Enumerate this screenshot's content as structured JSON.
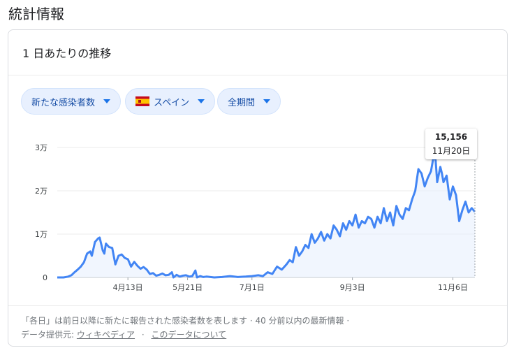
{
  "page": {
    "title": "統計情報"
  },
  "card": {
    "header": "1 日あたりの推移",
    "filters": [
      {
        "label": "新たな感染者数"
      },
      {
        "label": "スペイン",
        "flag": "spain-flag-icon"
      },
      {
        "label": "全期間"
      }
    ]
  },
  "tooltip": {
    "value": "15,156",
    "date": "11月20日"
  },
  "footer": {
    "note": "「各日」は前日以降に新たに報告された感染者数を表します · 40 分前以内の最新情報 ·",
    "provider_prefix": "データ提供元:",
    "provider_link": "ウィキペディア",
    "about_link": "このデータについて"
  },
  "colors": {
    "line": "#4285f4",
    "area": "#e8f0fe",
    "chip_bg": "#e8f0fe",
    "chip_text": "#174ea6"
  },
  "chart_data": {
    "type": "area",
    "ylim": [
      0,
      30000
    ],
    "y_ticks": [
      {
        "value": 0,
        "label": "0"
      },
      {
        "value": 10000,
        "label": "1万"
      },
      {
        "value": 20000,
        "label": "2万"
      },
      {
        "value": 30000,
        "label": "3万"
      }
    ],
    "x_ticks": [
      {
        "x": 45,
        "label": "4月13日"
      },
      {
        "x": 83,
        "label": "5月21日"
      },
      {
        "x": 124,
        "label": "7月1日"
      },
      {
        "x": 188,
        "label": "9月3日"
      },
      {
        "x": 252,
        "label": "11月6日"
      }
    ],
    "x_range": [
      0,
      266
    ],
    "series": [
      {
        "points": [
          [
            0,
            0
          ],
          [
            4,
            0
          ],
          [
            7,
            200
          ],
          [
            9,
            500
          ],
          [
            11,
            1200
          ],
          [
            13,
            1800
          ],
          [
            15,
            2500
          ],
          [
            17,
            3500
          ],
          [
            19,
            5500
          ],
          [
            21,
            6000
          ],
          [
            22,
            5000
          ],
          [
            24,
            8200
          ],
          [
            26,
            9000
          ],
          [
            27,
            9200
          ],
          [
            29,
            6200
          ],
          [
            30,
            5500
          ],
          [
            31,
            7800
          ],
          [
            33,
            7000
          ],
          [
            35,
            6800
          ],
          [
            37,
            3000
          ],
          [
            39,
            5000
          ],
          [
            41,
            5300
          ],
          [
            43,
            4500
          ],
          [
            45,
            4200
          ],
          [
            47,
            2500
          ],
          [
            49,
            3600
          ],
          [
            51,
            2700
          ],
          [
            53,
            2000
          ],
          [
            55,
            2400
          ],
          [
            57,
            1800
          ],
          [
            59,
            800
          ],
          [
            61,
            1000
          ],
          [
            63,
            400
          ],
          [
            65,
            600
          ],
          [
            67,
            900
          ],
          [
            69,
            500
          ],
          [
            71,
            600
          ],
          [
            73,
            1200
          ],
          [
            74,
            0
          ],
          [
            76,
            600
          ],
          [
            78,
            200
          ],
          [
            80,
            400
          ],
          [
            82,
            500
          ],
          [
            84,
            200
          ],
          [
            86,
            300
          ],
          [
            88,
            1600
          ],
          [
            89,
            0
          ],
          [
            91,
            300
          ],
          [
            93,
            100
          ],
          [
            95,
            200
          ],
          [
            100,
            0
          ],
          [
            105,
            100
          ],
          [
            110,
            300
          ],
          [
            115,
            100
          ],
          [
            120,
            200
          ],
          [
            124,
            300
          ],
          [
            128,
            500
          ],
          [
            131,
            300
          ],
          [
            134,
            1200
          ],
          [
            137,
            800
          ],
          [
            140,
            2500
          ],
          [
            143,
            1800
          ],
          [
            146,
            3000
          ],
          [
            148,
            4000
          ],
          [
            150,
            3500
          ],
          [
            152,
            7000
          ],
          [
            154,
            5000
          ],
          [
            156,
            6000
          ],
          [
            158,
            7500
          ],
          [
            160,
            6800
          ],
          [
            162,
            10000
          ],
          [
            164,
            8000
          ],
          [
            166,
            9000
          ],
          [
            168,
            10500
          ],
          [
            170,
            8500
          ],
          [
            172,
            10000
          ],
          [
            174,
            9000
          ],
          [
            176,
            12000
          ],
          [
            178,
            11000
          ],
          [
            180,
            9500
          ],
          [
            182,
            12500
          ],
          [
            184,
            11000
          ],
          [
            186,
            13000
          ],
          [
            188,
            12000
          ],
          [
            190,
            14500
          ],
          [
            192,
            11500
          ],
          [
            194,
            13000
          ],
          [
            196,
            12500
          ],
          [
            198,
            14000
          ],
          [
            200,
            13500
          ],
          [
            202,
            11500
          ],
          [
            204,
            14000
          ],
          [
            206,
            12500
          ],
          [
            208,
            16000
          ],
          [
            210,
            13000
          ],
          [
            212,
            15000
          ],
          [
            214,
            12000
          ],
          [
            216,
            16500
          ],
          [
            218,
            14500
          ],
          [
            220,
            13500
          ],
          [
            222,
            16000
          ],
          [
            224,
            15500
          ],
          [
            226,
            18000
          ],
          [
            228,
            20000
          ],
          [
            230,
            25000
          ],
          [
            232,
            24000
          ],
          [
            234,
            21000
          ],
          [
            236,
            23000
          ],
          [
            238,
            24500
          ],
          [
            240,
            28500
          ],
          [
            241,
            27000
          ],
          [
            242,
            22000
          ],
          [
            244,
            25500
          ],
          [
            245,
            24000
          ],
          [
            246,
            22000
          ],
          [
            248,
            23500
          ],
          [
            250,
            18000
          ],
          [
            252,
            21000
          ],
          [
            254,
            19000
          ],
          [
            256,
            13000
          ],
          [
            258,
            15500
          ],
          [
            260,
            17500
          ],
          [
            262,
            15000
          ],
          [
            264,
            16000
          ],
          [
            266,
            15156
          ]
        ]
      }
    ]
  }
}
